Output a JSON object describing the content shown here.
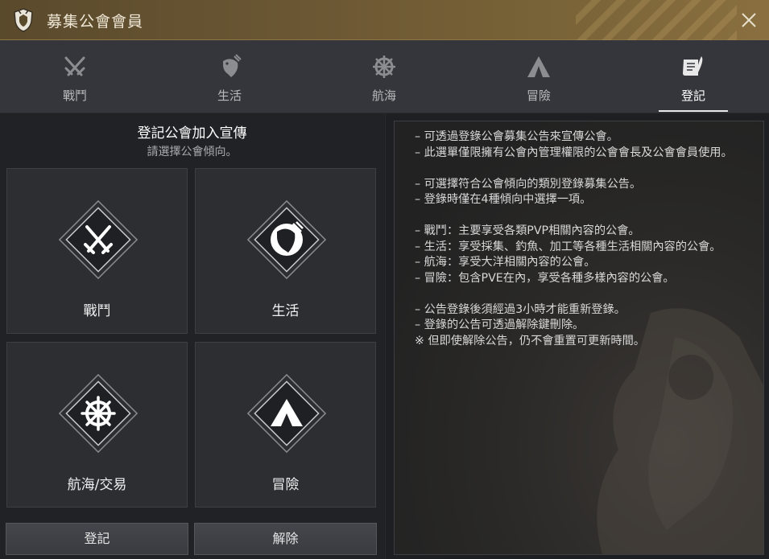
{
  "window": {
    "title": "募集公會會員"
  },
  "tabs": [
    {
      "label": "戰鬥",
      "icon": "crossed-swords-icon",
      "active": false
    },
    {
      "label": "生活",
      "icon": "fish-icon",
      "active": false
    },
    {
      "label": "航海",
      "icon": "ship-wheel-icon",
      "active": false
    },
    {
      "label": "冒險",
      "icon": "tent-icon",
      "active": false
    },
    {
      "label": "登記",
      "icon": "scroll-quill-icon",
      "active": true
    }
  ],
  "left_panel": {
    "title": "登記公會加入宣傳",
    "subtitle": "請選擇公會傾向。",
    "cards": [
      {
        "label": "戰鬥",
        "icon": "crossed-swords-icon"
      },
      {
        "label": "生活",
        "icon": "fish-icon"
      },
      {
        "label": "航海/交易",
        "icon": "ship-wheel-icon"
      },
      {
        "label": "冒險",
        "icon": "tent-icon"
      }
    ],
    "register_button": "登記",
    "remove_button": "解除"
  },
  "right_panel": {
    "description": "– 可透過登錄公會募集公告來宣傳公會。\n– 此選單僅限擁有公會內管理權限的公會會長及公會會員使用。\n\n– 可選擇符合公會傾向的類別登錄募集公告。\n– 登錄時僅在4種傾向中選擇一項。\n\n– 戰鬥：主要享受各類PVP相關內容的公會。\n– 生活：享受採集、釣魚、加工等各種生活相關內容的公會。\n– 航海：享受大洋相關內容的公會。\n– 冒險：包含PVE在內，享受各種多樣內容的公會。\n\n– 公告登錄後須經過3小時才能重新登錄。\n– 登錄的公告可透過解除鍵刪除。\n※ 但即使解除公告，仍不會重置可更新時間。"
  },
  "colors": {
    "title_bar": "#6b5733",
    "panel_bg": "#212226",
    "card_bg": "#2d2e32",
    "text": "#d8d8d8"
  }
}
